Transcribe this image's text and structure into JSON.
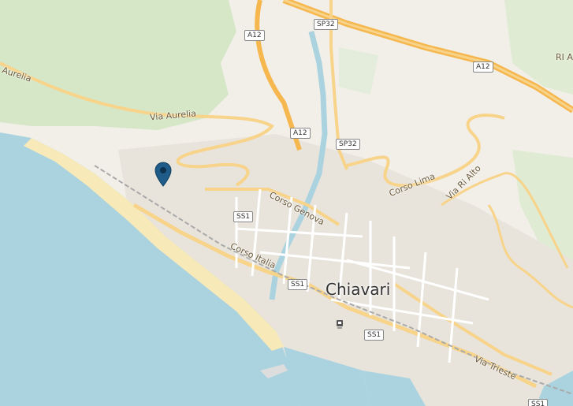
{
  "map": {
    "city": "Chiavari",
    "streets": {
      "via_aurelia": "Via Aurelia",
      "aurelia": "Aurelia",
      "corso_genova": "Corso Genova",
      "corso_italia": "Corso Italia",
      "corso_lima": "Corso Lima",
      "via_ri_alto": "Via Ri Alto",
      "via_trieste": "Via Trieste",
      "ri_a": "RI A"
    },
    "shields": {
      "a12_top": "A12",
      "sp32_top": "SP32",
      "a12_right": "A12",
      "a12_mid": "A12",
      "sp32_mid": "SP32",
      "ss1_a": "SS1",
      "ss1_b": "SS1",
      "ss1_c": "SS1",
      "ss1_d": "SS1"
    },
    "marker_icon": "map-pin-icon",
    "station_icon": "train-station-icon"
  }
}
